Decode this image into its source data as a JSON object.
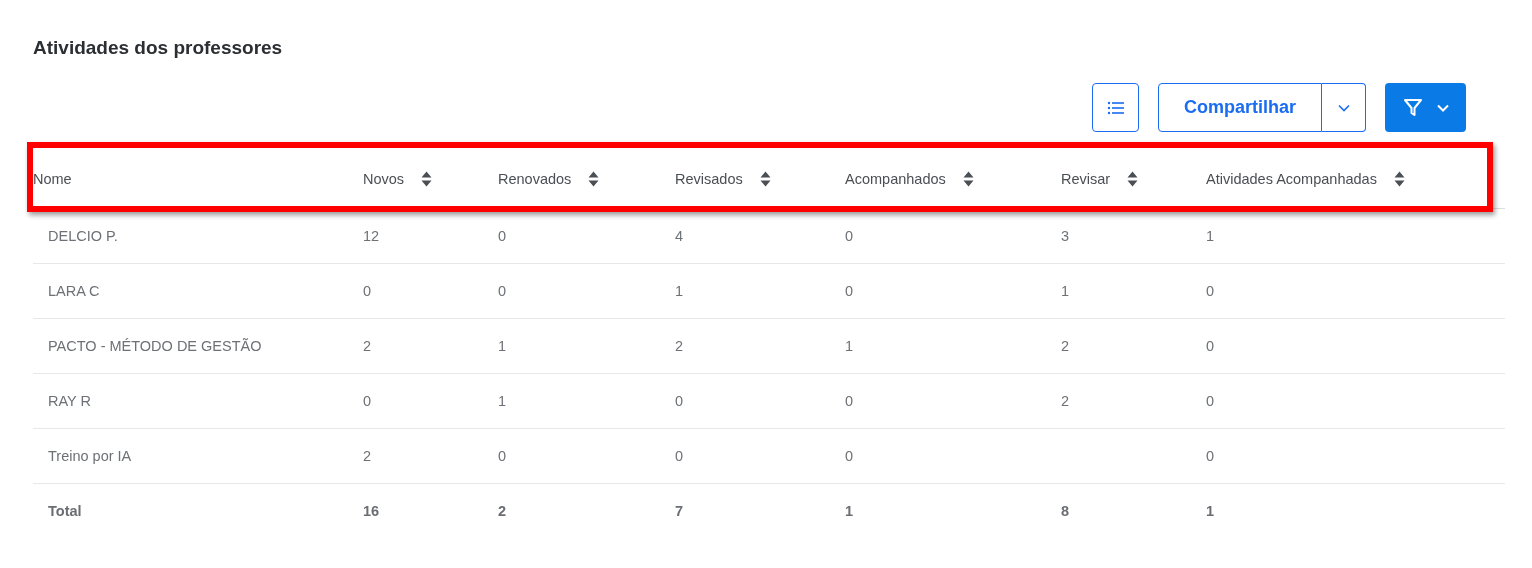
{
  "title": "Atividades dos professores",
  "toolbar": {
    "share_label": "Compartilhar"
  },
  "table": {
    "highlighted_header": true,
    "columns": [
      {
        "label": "Nome",
        "sortable": false
      },
      {
        "label": "Novos",
        "sortable": true
      },
      {
        "label": "Renovados",
        "sortable": true
      },
      {
        "label": "Revisados",
        "sortable": true
      },
      {
        "label": "Acompanhados",
        "sortable": true
      },
      {
        "label": "Revisar",
        "sortable": true
      },
      {
        "label": "Atividades Acompanhadas",
        "sortable": true
      }
    ],
    "rows": [
      {
        "cells": [
          "DELCIO P.",
          "12",
          "0",
          "4",
          "0",
          "3",
          "1"
        ]
      },
      {
        "cells": [
          "LARA C",
          "0",
          "0",
          "1",
          "0",
          "1",
          "0"
        ]
      },
      {
        "cells": [
          "PACTO - MÉTODO DE GESTÃO",
          "2",
          "1",
          "2",
          "1",
          "2",
          "0"
        ]
      },
      {
        "cells": [
          "RAY R",
          "0",
          "1",
          "0",
          "0",
          "2",
          "0"
        ]
      },
      {
        "cells": [
          "Treino por IA",
          "2",
          "0",
          "0",
          "0",
          null,
          "0"
        ]
      }
    ],
    "total": {
      "cells": [
        "Total",
        "16",
        "2",
        "7",
        "1",
        "8",
        "1"
      ]
    }
  }
}
